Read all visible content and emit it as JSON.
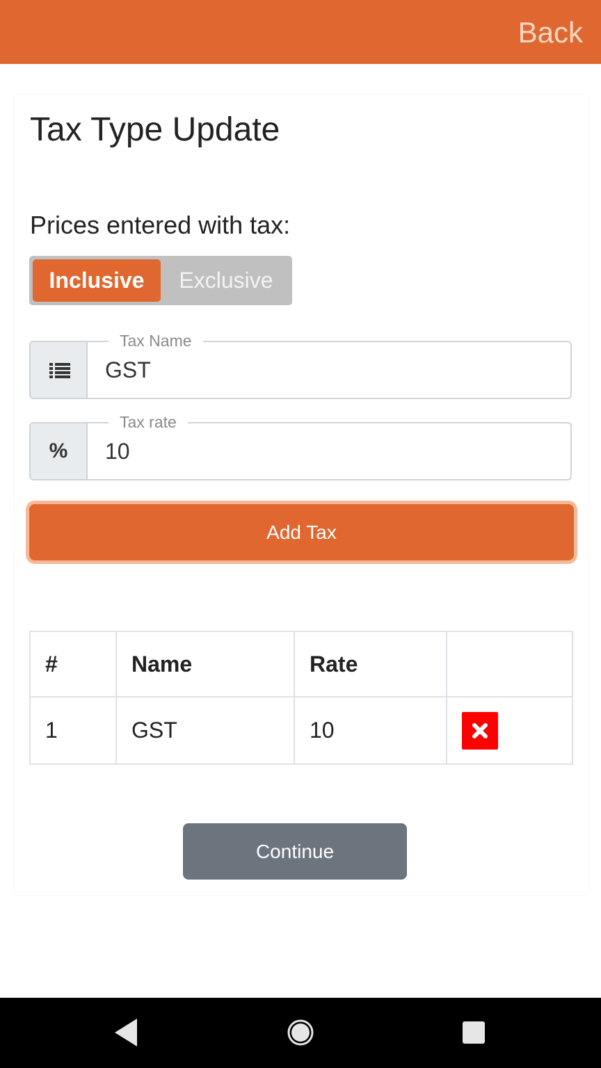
{
  "colors": {
    "accent": "#e0672f",
    "accent_glow": "#f6b998",
    "secondary": "#6c757d",
    "danger": "#ff0000"
  },
  "header": {
    "back_label": "Back"
  },
  "page": {
    "title": "Tax Type Update"
  },
  "form": {
    "prices_label": "Prices entered with tax:",
    "toggle": {
      "options": [
        "Inclusive",
        "Exclusive"
      ],
      "selected": "Inclusive"
    },
    "tax_name": {
      "label": "Tax Name",
      "value": "GST",
      "icon": "list-icon"
    },
    "tax_rate": {
      "label": "Tax rate",
      "value": "10",
      "icon": "percent-icon",
      "icon_glyph": "%"
    },
    "add_button": "Add Tax"
  },
  "table": {
    "headers": [
      "#",
      "Name",
      "Rate",
      ""
    ],
    "rows": [
      {
        "num": "1",
        "name": "GST",
        "rate": "10",
        "action_icon": "delete-icon"
      }
    ]
  },
  "footer": {
    "continue_button": "Continue"
  },
  "navbar": {
    "icons": [
      "back-triangle-icon",
      "home-circle-icon",
      "recents-square-icon"
    ]
  }
}
